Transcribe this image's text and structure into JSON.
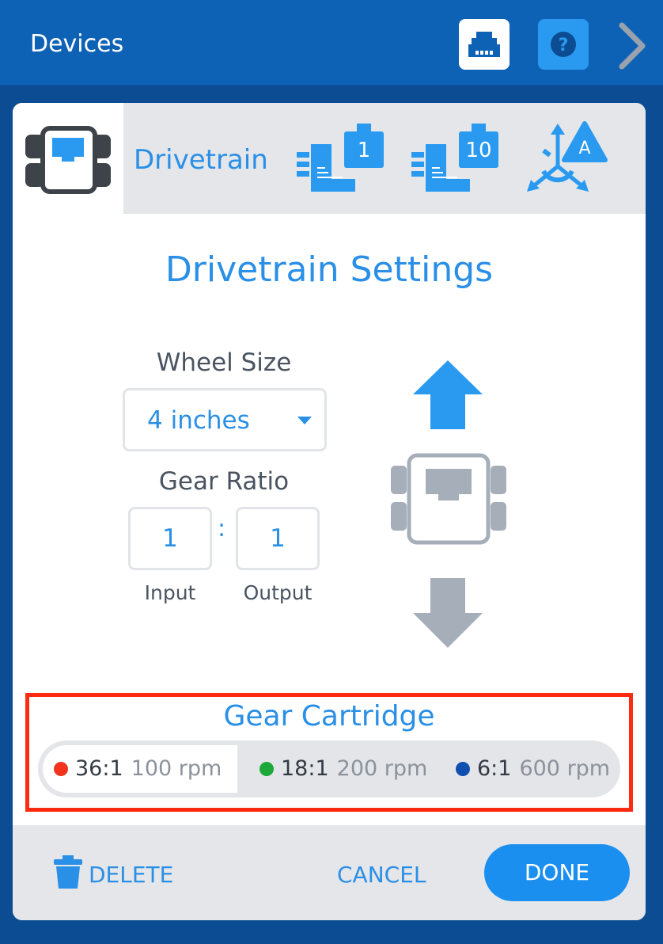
{
  "header": {
    "title": "Devices",
    "port_icon": "ethernet-port-icon",
    "help_icon": "help-icon",
    "next_icon": "chevron-right-icon"
  },
  "tabs": {
    "drivetrain_label": "Drivetrain",
    "motor_1_badge": "1",
    "motor_10_badge": "10",
    "inertial_badge": "A"
  },
  "settings": {
    "title": "Drivetrain Settings",
    "wheel_size_label": "Wheel Size",
    "wheel_size_value": "4 inches",
    "gear_ratio_label": "Gear Ratio",
    "ratio_input": "1",
    "ratio_separator": ":",
    "ratio_output": "1",
    "input_label": "Input",
    "output_label": "Output"
  },
  "cartridge": {
    "title": "Gear Cartridge",
    "options": [
      {
        "ratio": "36:1",
        "rpm": "100 rpm",
        "color": "#f2331d",
        "selected": true
      },
      {
        "ratio": "18:1",
        "rpm": "200 rpm",
        "color": "#1da83a",
        "selected": false
      },
      {
        "ratio": "6:1",
        "rpm": "600 rpm",
        "color": "#0f4fb0",
        "selected": false
      }
    ]
  },
  "footer": {
    "delete_label": "DELETE",
    "cancel_label": "CANCEL",
    "done_label": "DONE"
  },
  "colors": {
    "accent": "#2a8fe6",
    "header_bg": "#0e62b5",
    "highlight_border": "#ff2a12"
  }
}
